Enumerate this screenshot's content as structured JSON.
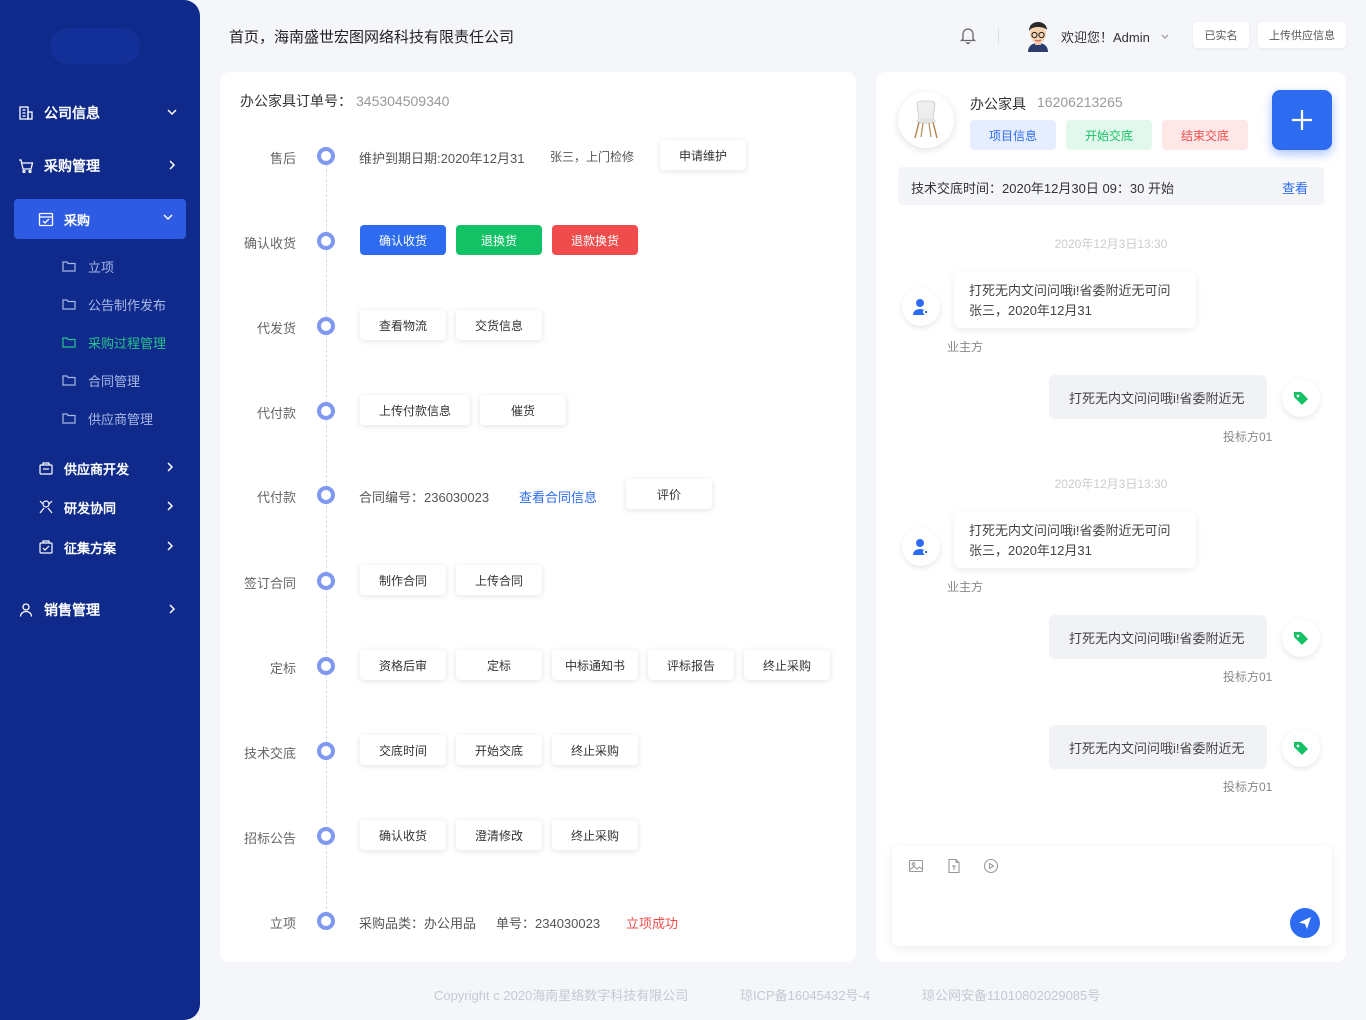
{
  "sidebar": {
    "menu": [
      {
        "label": "公司信息",
        "icon": "building-icon",
        "arrow": "chevron-down"
      },
      {
        "label": "采购管理",
        "icon": "cart-icon",
        "arrow": "chevron-right"
      }
    ],
    "active": {
      "label": "采购",
      "icon": "calendar-icon",
      "arrow": "chevron-down"
    },
    "sub_items": [
      "立项",
      "公告制作发布",
      "采购过程管理",
      "合同管理",
      "供应商管理"
    ],
    "sub_active_index": 2,
    "sections": [
      {
        "label": "供应商开发",
        "icon": "supplier-icon"
      },
      {
        "label": "研发协同",
        "icon": "collab-icon"
      },
      {
        "label": "征集方案",
        "icon": "scheme-icon"
      }
    ],
    "sales": {
      "label": "销售管理",
      "icon": "user-icon"
    }
  },
  "header": {
    "title": "首页，海南盛世宏图网络科技有限责任公司",
    "welcome": "欢迎您！Admin",
    "btn_verified": "已实名",
    "btn_upload": "上传供应信息"
  },
  "order": {
    "label": "办公家具订单号：",
    "number": "345304509340",
    "timeline": [
      {
        "label": "售后",
        "texts": [
          "维护到期日期:2020年12月31",
          "张三，上门检修"
        ],
        "buttons": [
          "申请维护"
        ]
      },
      {
        "label": "确认收货",
        "texts": [],
        "color_buttons": [
          "确认收货",
          "退换货",
          "退款换货"
        ]
      },
      {
        "label": "代发货",
        "texts": [],
        "buttons": [
          "查看物流",
          "交货信息"
        ]
      },
      {
        "label": "代付款",
        "texts": [],
        "buttons": [
          "上传付款信息",
          "催货"
        ]
      },
      {
        "label": "代付款",
        "texts": [
          "合同编号：236030023"
        ],
        "link": "查看合同信息",
        "buttons": [
          "评价"
        ]
      },
      {
        "label": "签订合同",
        "texts": [],
        "buttons": [
          "制作合同",
          "上传合同"
        ]
      },
      {
        "label": "定标",
        "texts": [],
        "buttons": [
          "资格后审",
          "定标",
          "中标通知书",
          "评标报告",
          "终止采购"
        ]
      },
      {
        "label": "技术交底",
        "texts": [],
        "buttons": [
          "交底时间",
          "开始交底",
          "终止采购"
        ]
      },
      {
        "label": "招标公告",
        "texts": [],
        "buttons": [
          "确认收货",
          "澄清修改",
          "终止采购"
        ]
      },
      {
        "label": "立项",
        "texts": [
          "采购品类：办公用品",
          "单号：234030023"
        ],
        "success": "立项成功"
      }
    ]
  },
  "product": {
    "name": "办公家具",
    "phone": "16206213265",
    "tags": [
      "项目信息",
      "开始交底",
      "结束交底"
    ],
    "notice": "技术交底时间：2020年12月30日 09：30 开始",
    "notice_link": "查看"
  },
  "chat": {
    "time1": "2020年12月3日13:30",
    "time2": "2020年12月3日13:30",
    "in_line1": "打死无内文问问哦i!省委附近无可问",
    "in_line2": "张三，2020年12月31",
    "in_sender": "业主方",
    "out_text": "打死无内文问问哦i!省委附近无",
    "out_sender": "投标方01"
  },
  "footer": {
    "copyright": "Copyright c 2020海南星络数字科技有限公司",
    "icp": "琼ICP备16045432号-4",
    "police": "琼公网安备11010802029085号"
  },
  "colors": {
    "sidebar": "#0f2a8a",
    "active": "#2d5be3",
    "primary": "#2d6cf0",
    "green": "#14c266",
    "red": "#f04c4c",
    "timeline_dot": "#7f98f0",
    "submenu_active": "#28c28c"
  }
}
